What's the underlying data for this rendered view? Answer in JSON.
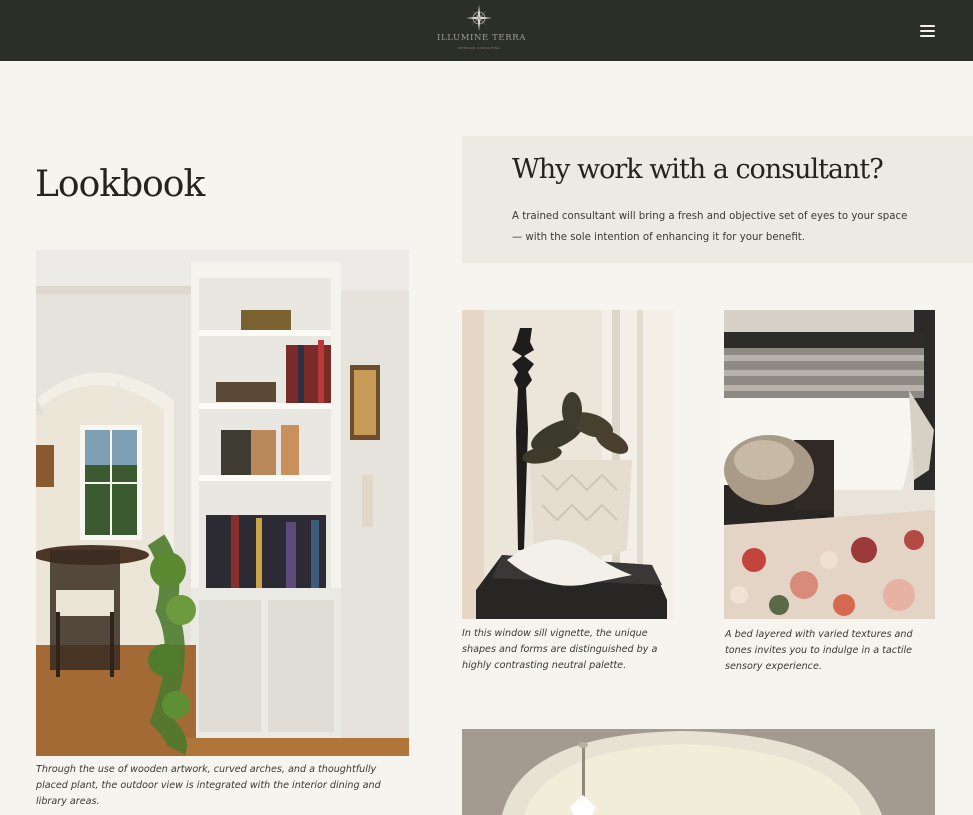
{
  "header": {
    "brand_name": "ILLUMINE TERRA",
    "brand_tagline": "INTERIOR CONSULTING",
    "logo_icon": "compass-star-icon",
    "menu_icon": "hamburger-menu-icon",
    "bg_color": "#2c2e28"
  },
  "lookbook": {
    "title": "Lookbook",
    "main_caption": "Through the use of wooden artwork, curved arches, and a thoughtfully placed plant, the outdoor view is integrated with the interior dining and library areas."
  },
  "why": {
    "title": "Why work with a consultant?",
    "body": "A trained consultant will bring a fresh and objective set of eyes to your space — with the sole intention of enhancing it for your benefit."
  },
  "gallery": {
    "captions": [
      "In this window sill vignette, the unique shapes and forms are distinguished by a highly contrasting neutral palette.",
      "A bed layered with varied textures and tones invites you to indulge in a tactile sensory experience."
    ]
  },
  "colors": {
    "page_bg": "#f6f4ef",
    "panel_bg": "#ecebe3",
    "text": "#24241f"
  }
}
